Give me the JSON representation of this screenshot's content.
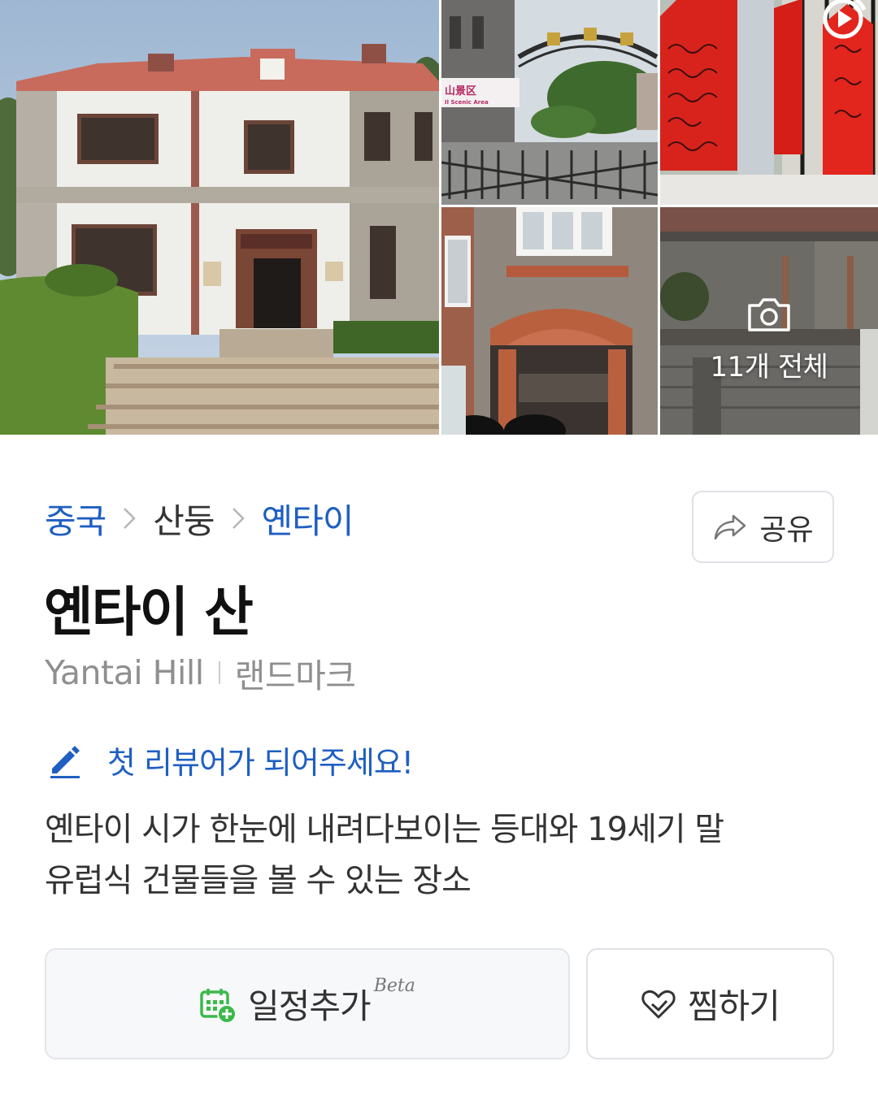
{
  "gallery": {
    "more_label": "11개 전체",
    "gate_sign_text": "山景区",
    "gate_sign_sub": "Il Scenic Area",
    "icons": [
      "video-play-icon",
      "camera-icon"
    ]
  },
  "breadcrumb": {
    "country": "중국",
    "province": "산둥",
    "city": "옌타이"
  },
  "share": {
    "label": "공유",
    "icon": "share-arrow-icon"
  },
  "place": {
    "title": "옌타이 산",
    "english_name": "Yantai Hill",
    "category": "랜드마크"
  },
  "review": {
    "prompt": "첫 리뷰어가 되어주세요!",
    "icon": "pencil-icon"
  },
  "description": {
    "line1": "옌타이 시가 한눈에 내려다보이는 등대와 19세기 말",
    "line2": "유럽식 건물들을 볼 수 있는 장소"
  },
  "actions": {
    "schedule_label": "일정추가",
    "schedule_badge": "Beta",
    "wish_label": "찜하기"
  },
  "colors": {
    "link_blue": "#1f5fc2",
    "schedule_green": "#3cb94a",
    "text_gray": "#8f8f8f"
  }
}
